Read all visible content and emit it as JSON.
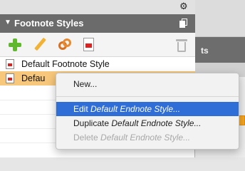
{
  "panel": {
    "title": "Footnote Styles",
    "collapse_icon": "triangle-down-icon",
    "gear_icon": "gear-icon",
    "copy_icon": "copy-icon"
  },
  "toolbar": {
    "icons": [
      "plus-icon",
      "pencil-icon",
      "link-icon",
      "style-document-icon",
      "trash-icon"
    ]
  },
  "styles": [
    {
      "label": "Default Footnote Style",
      "selected": false
    },
    {
      "label": "Defau",
      "selected": true
    }
  ],
  "background_window": {
    "header_fragment": "ts"
  },
  "context_menu": {
    "new": "New...",
    "edit_prefix": "Edit ",
    "edit_target": "Default Endnote Style...",
    "duplicate_prefix": "Duplicate ",
    "duplicate_target": "Default Endnote Style...",
    "delete_prefix": "Delete ",
    "delete_target": "Default Endnote Style...",
    "highlight_color": "#2f6dd7"
  }
}
